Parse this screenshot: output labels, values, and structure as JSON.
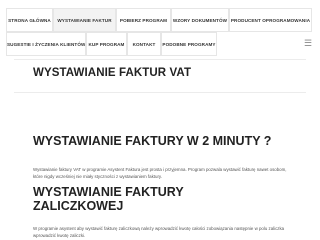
{
  "nav": {
    "row1": [
      "STRONA GŁÓWNA",
      "WYSTAWIANIE FAKTUR",
      "POBIERZ PROGRAM",
      "WZORY DOKUMENTÓW",
      "PRODUCENT OPROGRAMOWANIA"
    ],
    "row2": [
      "SUGESTIE I ŻYCZENIA KLIENTÓW",
      "KUP PROGRAM",
      "KONTAKT",
      "PODOBNE PROGRAMY"
    ],
    "active_index": 1,
    "toggle_icon": "hamburger-icon"
  },
  "page": {
    "title": "WYSTAWIANIE FAKTUR VAT"
  },
  "sections": [
    {
      "heading": "WYSTAWIANIE FAKTURY W 2 MINUTY ?",
      "text": "Wystawianie faktury VAT w programie Asystent Faktura jest prosta i przyjemna. Program pozwala wystawić fakturę nawet osobom, które nigdy wcześniej nie miały styczności z wystawianiem faktury."
    },
    {
      "heading": "WYSTAWIANIE FAKTURY ZALICZKOWEJ",
      "text": "W programie asystent aby wystawić fakturę zaliczkową należy wprowadzić kwotę całości zobowiązania następnie w polu zaliczka wprowadzić kwotę zaliczki."
    }
  ]
}
